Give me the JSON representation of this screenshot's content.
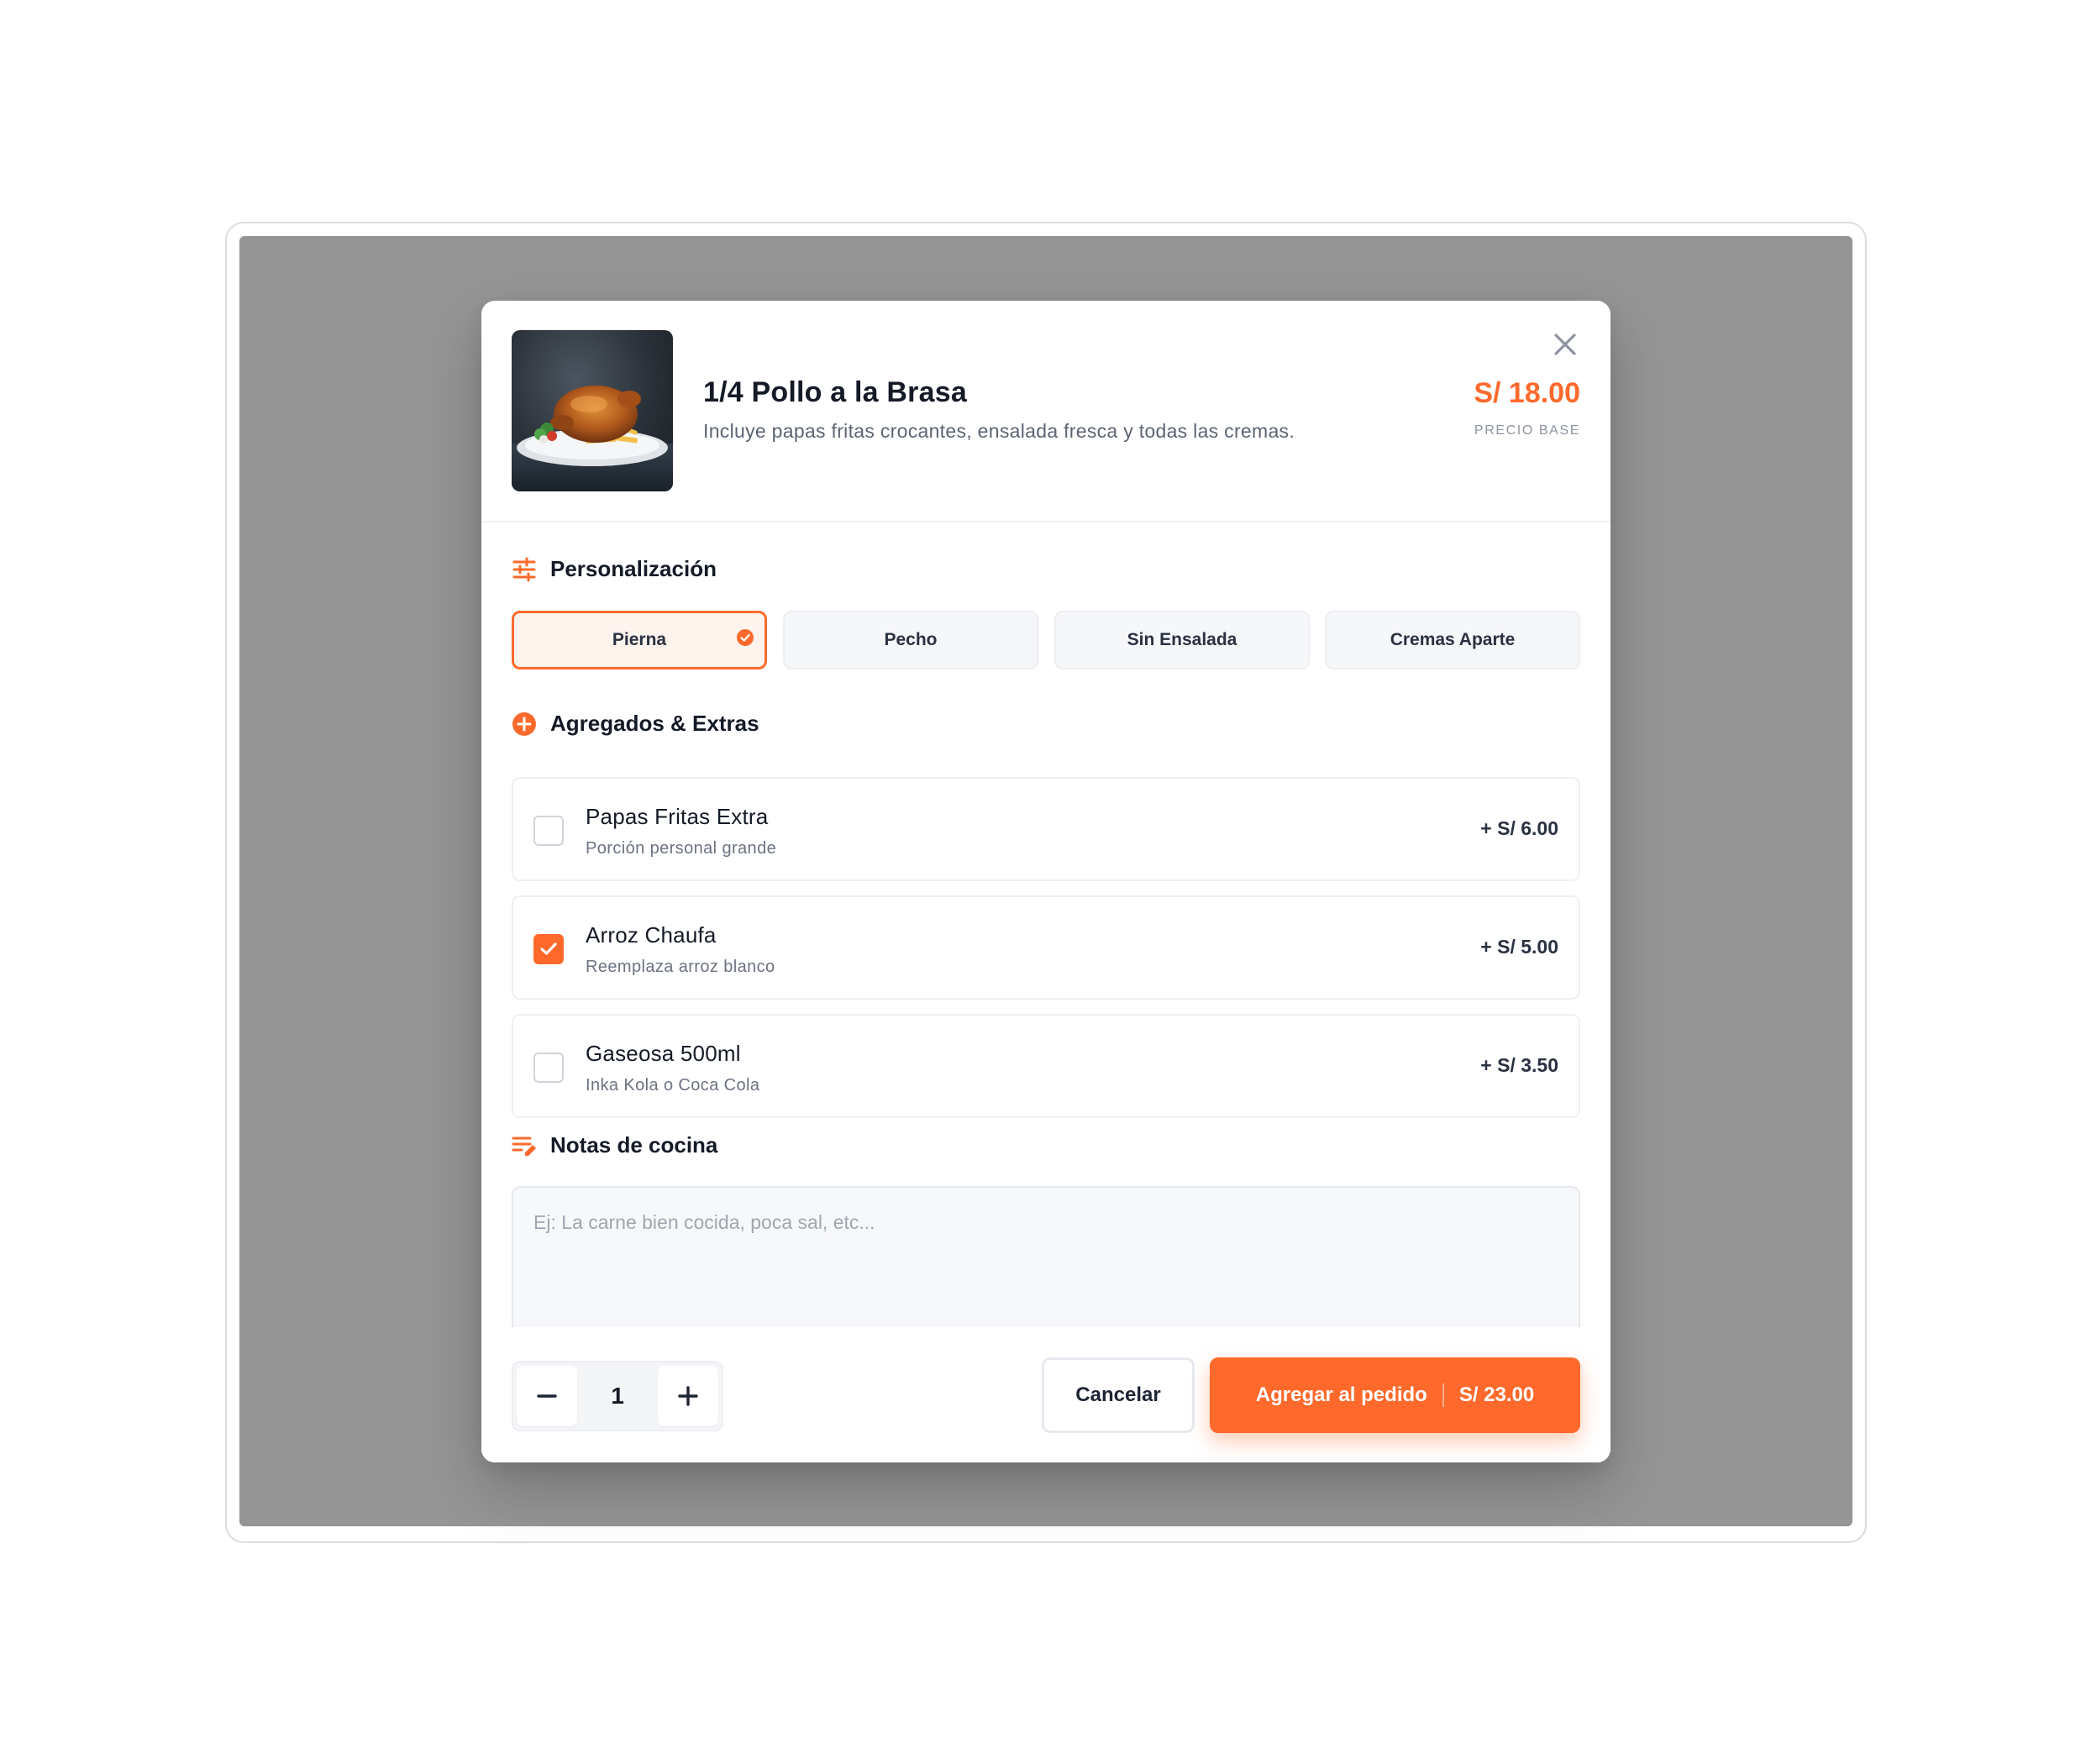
{
  "product": {
    "title": "1/4 Pollo a la Brasa",
    "description": "Incluye papas fritas crocantes, ensalada fresca y todas las cremas.",
    "price": "S/ 18.00",
    "price_label": "PRECIO BASE"
  },
  "personalization": {
    "title": "Personalización",
    "options": [
      {
        "label": "Pierna",
        "selected": true
      },
      {
        "label": "Pecho",
        "selected": false
      },
      {
        "label": "Sin Ensalada",
        "selected": false
      },
      {
        "label": "Cremas Aparte",
        "selected": false
      }
    ]
  },
  "extras": {
    "title": "Agregados & Extras",
    "items": [
      {
        "name": "Papas Fritas Extra",
        "sub": "Porción personal grande",
        "price": "+ S/ 6.00",
        "checked": false
      },
      {
        "name": "Arroz Chaufa",
        "sub": "Reemplaza arroz blanco",
        "price": "+ S/ 5.00",
        "checked": true
      },
      {
        "name": "Gaseosa 500ml",
        "sub": "Inka Kola o Coca Cola",
        "price": "+ S/ 3.50",
        "checked": false
      }
    ]
  },
  "notes": {
    "title": "Notas de cocina",
    "placeholder": "Ej: La carne bien cocida, poca sal, etc...",
    "value": ""
  },
  "footer": {
    "quantity": "1",
    "cancel_label": "Cancelar",
    "add_label": "Agregar al pedido",
    "add_total": "S/ 23.00"
  },
  "colors": {
    "accent": "#ff6a2c",
    "overlay": "#959595"
  },
  "icons": {
    "close": "close-icon",
    "personalization": "sliders-icon",
    "extras": "plus-circle-icon",
    "notes": "notes-edit-icon",
    "minus": "minus-icon",
    "plus": "plus-icon",
    "check": "check-icon"
  }
}
